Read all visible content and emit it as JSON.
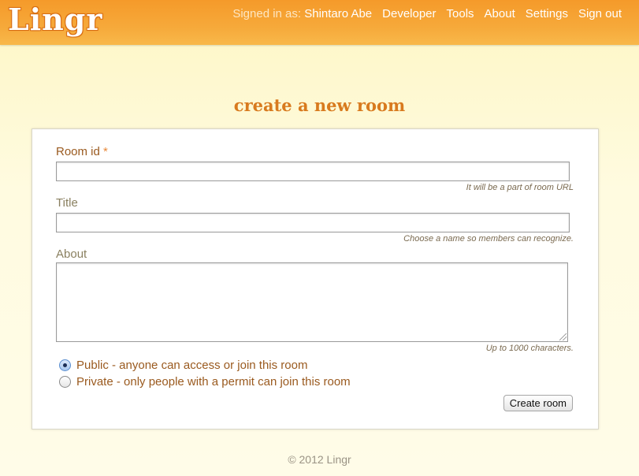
{
  "header": {
    "logo_text": "Lingr",
    "signed_in_prefix": "Signed in as:",
    "user_name": "Shintaro Abe",
    "nav_items": [
      "Developer",
      "Tools",
      "About",
      "Settings",
      "Sign out"
    ]
  },
  "page": {
    "title": "create a new room"
  },
  "form": {
    "room_id": {
      "label": "Room id",
      "required_mark": "*",
      "value": "",
      "hint": "It will be a part of room URL"
    },
    "title": {
      "label": "Title",
      "value": "",
      "hint": "Choose a name so members can recognize."
    },
    "about": {
      "label": "About",
      "value": "",
      "hint": "Up to 1000 characters."
    },
    "visibility": {
      "options": [
        {
          "label": "Public - anyone can access or join this room",
          "selected": true
        },
        {
          "label": "Private - only people with a permit can join this room",
          "selected": false
        }
      ]
    },
    "submit_label": "Create room"
  },
  "footer": {
    "copyright": "© 2012 Lingr"
  },
  "colors": {
    "header_orange": "#f59a2a",
    "heading_orange": "#d87a1e",
    "label_brown": "#9a5a1f"
  }
}
